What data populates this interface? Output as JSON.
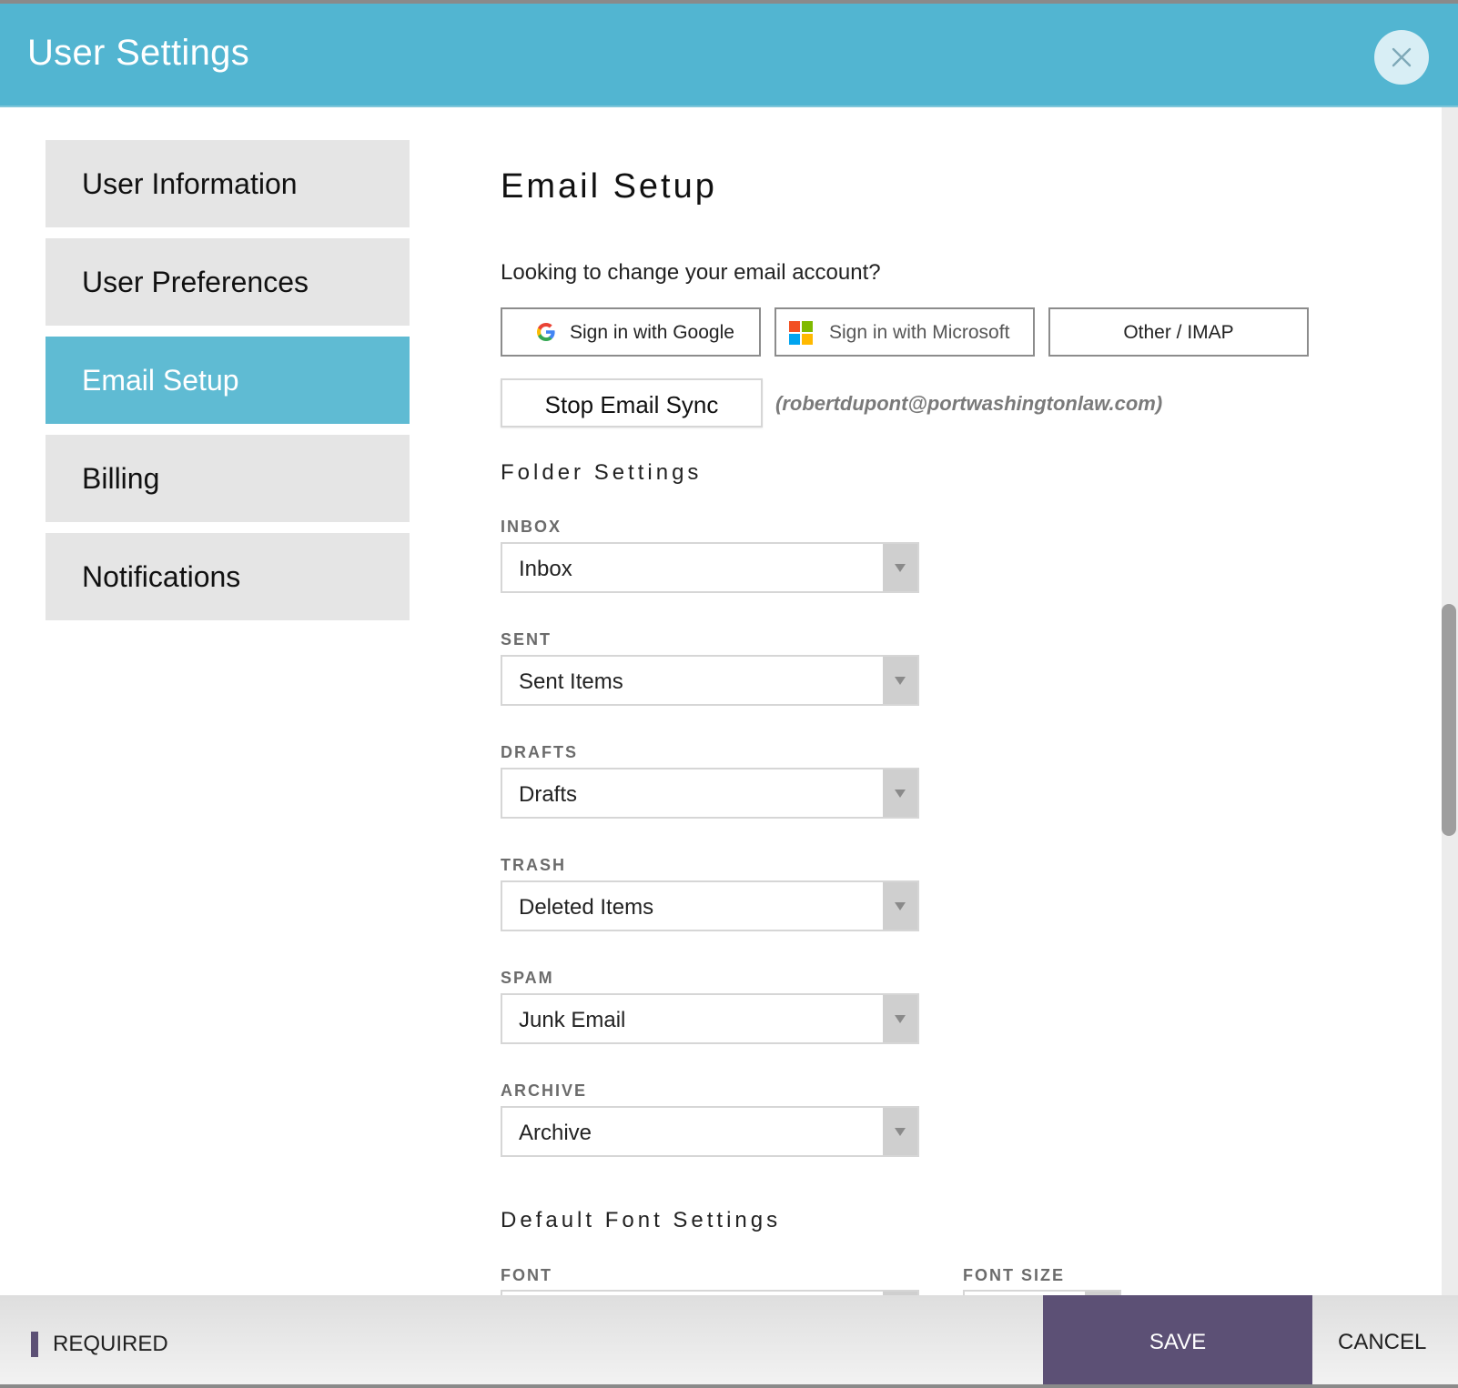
{
  "header": {
    "title": "User Settings",
    "close_icon": "close-icon"
  },
  "sidebar": {
    "items": [
      {
        "label": "User Information",
        "active": false
      },
      {
        "label": "User Preferences",
        "active": false
      },
      {
        "label": "Email Setup",
        "active": true
      },
      {
        "label": "Billing",
        "active": false
      },
      {
        "label": "Notifications",
        "active": false
      }
    ]
  },
  "main": {
    "title": "Email Setup",
    "question": "Looking to change your email account?",
    "auth_buttons": {
      "google": "Sign in with Google",
      "microsoft": "Sign in with Microsoft",
      "other": "Other / IMAP"
    },
    "stop_sync": "Stop Email Sync",
    "connected_email": "(robertdupont@portwashingtonlaw.com)",
    "folder_settings": {
      "title": "Folder Settings",
      "fields": [
        {
          "label": "INBOX",
          "value": "Inbox"
        },
        {
          "label": "SENT",
          "value": "Sent Items"
        },
        {
          "label": "DRAFTS",
          "value": "Drafts"
        },
        {
          "label": "TRASH",
          "value": "Deleted Items"
        },
        {
          "label": "SPAM",
          "value": "Junk Email"
        },
        {
          "label": "ARCHIVE",
          "value": "Archive"
        }
      ]
    },
    "font_settings": {
      "title": "Default Font Settings",
      "font_label": "FONT",
      "size_label": "FONT SIZE"
    }
  },
  "footer": {
    "required": "REQUIRED",
    "save": "SAVE",
    "cancel": "CANCEL"
  },
  "colors": {
    "header": "#52b5d1",
    "active_tab": "#5fbbd3",
    "primary_button": "#5c5075"
  }
}
